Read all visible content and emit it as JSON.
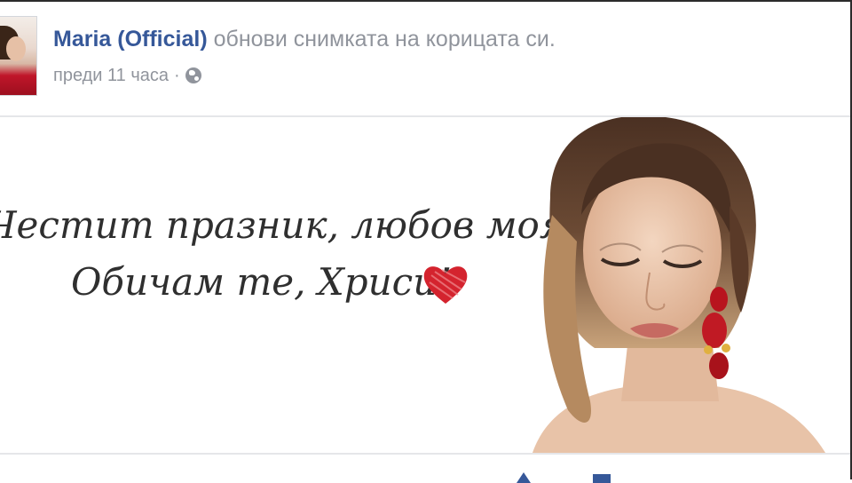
{
  "post": {
    "author": "Maria (Official)",
    "action": "обнови снимката на корицата си.",
    "time": "преди 11 часа",
    "separator": "·",
    "privacy_icon": "globe-icon"
  },
  "cover": {
    "line1": "Честит празник, любов моя...",
    "line2": "Обичам те, Хриси!",
    "heart_icon": "heart-icon",
    "heart_color": "#d4232e"
  },
  "colors": {
    "link": "#365899",
    "meta": "#90949c",
    "divider": "#e5e6e9"
  }
}
